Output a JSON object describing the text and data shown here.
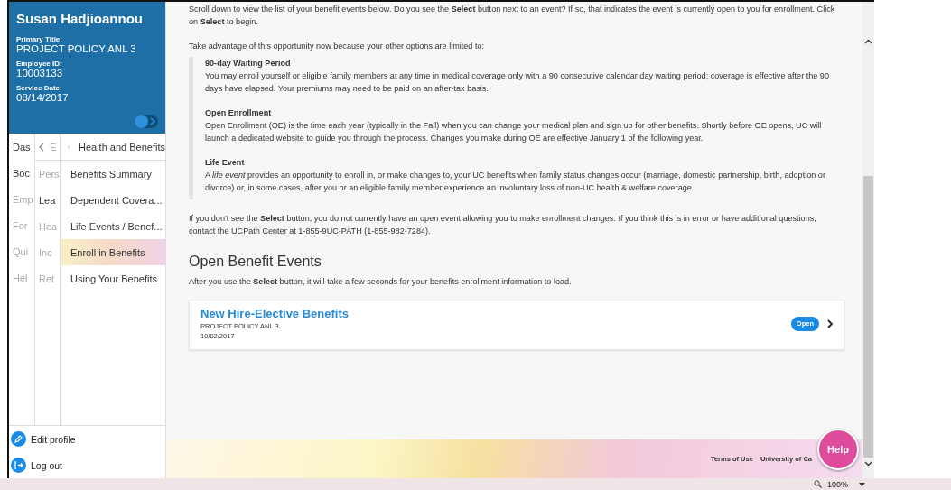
{
  "profile": {
    "name": "Susan Hadjioannou",
    "fields": [
      {
        "label": "Primary Title:",
        "value": "PROJECT POLICY ANL 3"
      },
      {
        "label": "Employee ID:",
        "value": "10003133"
      },
      {
        "label": "Service Date:",
        "value": "03/14/2017"
      }
    ]
  },
  "nav": {
    "column_1": [
      {
        "label": "Das",
        "dim": false
      },
      {
        "label": "Boc",
        "dim": false
      },
      {
        "label": "Emp",
        "dim": true
      },
      {
        "label": "For",
        "dim": true
      },
      {
        "label": "Qui",
        "dim": true
      },
      {
        "label": "Hel",
        "dim": true
      }
    ],
    "column_2": {
      "back": "E",
      "items": [
        {
          "label": "Pers",
          "dim": true
        },
        {
          "label": "Lea",
          "dim": false
        },
        {
          "label": "Hea",
          "dim": true
        },
        {
          "label": "Inc",
          "dim": true
        },
        {
          "label": "Ret",
          "dim": true
        }
      ]
    },
    "column_3": {
      "title": "Health and Benefits",
      "items": [
        {
          "label": "Benefits Summary",
          "selected": false
        },
        {
          "label": "Dependent Covera...",
          "selected": false
        },
        {
          "label": "Life Events / Benef...",
          "selected": false
        },
        {
          "label": "Enroll in Benefits",
          "selected": true
        },
        {
          "label": "Using Your Benefits",
          "selected": false
        }
      ]
    }
  },
  "sidebar_actions": [
    "Edit profile",
    "Log out"
  ],
  "content": {
    "intro": [
      "Scroll down to view the list of your benefit events below. Do you see the **Select** button next to an event? If so, that indicates the event is currently open to you for enrollment. Click on **Select** to begin.",
      "Take advantage of this opportunity now because your other options are limited to:"
    ],
    "options": [
      {
        "title": "90-day Waiting Period",
        "text": "You may enroll yourself or eligible family members at any time in medical coverage only with a 90 consecutive calendar day waiting period; coverage is effective after the 90 days have elapsed. Your premiums may need to be paid on an after-tax basis."
      },
      {
        "title": "Open Enrollment",
        "text": "Open Enrollment (OE) is the time each year (typically in the Fall) when you can change your medical plan and sign up for other benefits. Shortly before OE opens, UC will launch a dedicated website to guide you through the process. Changes you make during OE are effective January 1 of the following year."
      },
      {
        "title": "Life Event",
        "text": "A *life event* provides an opportunity to enroll in, or make changes to, your UC benefits when family status changes occur (marriage, domestic partnership, birth, adoption or divorce) or, in some cases, after you or an eligible family member experience an involuntary loss of non-UC health & welfare coverage."
      }
    ],
    "note": "If you don't see the **Select** button, you do not currently have an open event allowing you to make enrollment changes. If you think this is in error or have additional questions, contact the UCPath Center at 1-855-9UC-PATH (1-855-982-7284).",
    "section_title": "Open Benefit Events",
    "section_text": "After you use the **Select** button, it will take a few seconds for your benefits enrollment information to load.",
    "events": [
      {
        "title": "New Hire-Elective Benefits",
        "subtitle": "PROJECT POLICY ANL 3",
        "date": "10/02/2017",
        "status": "Open"
      }
    ]
  },
  "footer": {
    "links": [
      "Terms of Use",
      "University of Ca"
    ],
    "help": "Help"
  },
  "status_bar": {
    "zoom": "100%"
  }
}
